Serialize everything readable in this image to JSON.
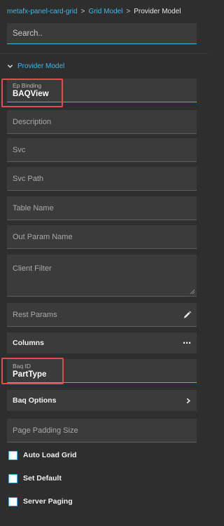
{
  "breadcrumb": {
    "items": [
      "metafx-panel-card-grid",
      "Grid Model"
    ],
    "separator": ">",
    "current": "Provider Model"
  },
  "search": {
    "placeholder": "Search.."
  },
  "section": {
    "title": "Provider Model",
    "expanded": true
  },
  "fields": {
    "ep_binding": {
      "label": "Ep Binding",
      "value": "BAQView"
    },
    "description": {
      "placeholder": "Description"
    },
    "svc": {
      "placeholder": "Svc"
    },
    "svc_path": {
      "placeholder": "Svc Path"
    },
    "table_name": {
      "placeholder": "Table Name"
    },
    "out_param_name": {
      "placeholder": "Out Param Name"
    },
    "client_filter": {
      "placeholder": "Client Filter"
    },
    "rest_params": {
      "placeholder": "Rest Params"
    },
    "baq_id": {
      "label": "Baq ID",
      "value": "PartType"
    },
    "page_padding_size": {
      "placeholder": "Page Padding Size"
    }
  },
  "rows": {
    "columns": {
      "label": "Columns",
      "icon": "more-horizontal-icon"
    },
    "baq_options": {
      "label": "Baq Options",
      "icon": "chevron-right-icon"
    }
  },
  "checkboxes": [
    {
      "label": "Auto Load Grid",
      "checked": false
    },
    {
      "label": "Set Default",
      "checked": false
    },
    {
      "label": "Server Paging",
      "checked": false
    }
  ],
  "colors": {
    "accent": "#41b6e6",
    "highlight": "#e74c4c",
    "background": "#2e2e2e",
    "field": "#3b3b3b"
  }
}
